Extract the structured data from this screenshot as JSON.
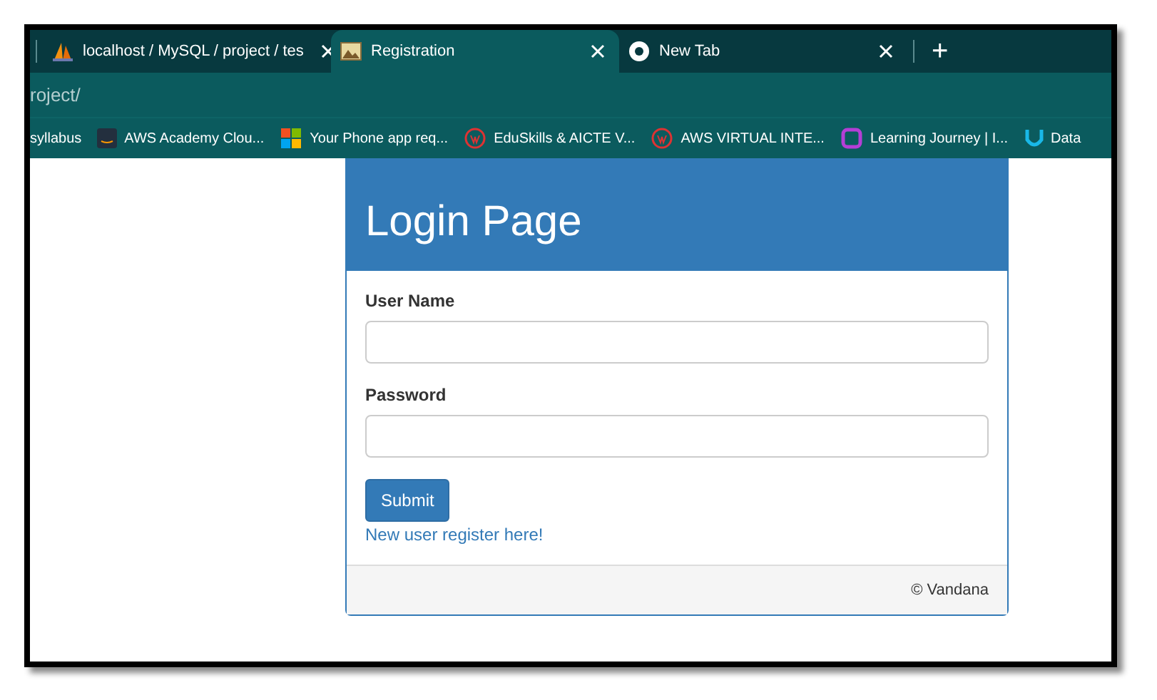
{
  "tabs": [
    {
      "title": "localhost / MySQL / project / tes",
      "selected": false
    },
    {
      "title": "Registration",
      "selected": true
    },
    {
      "title": "New Tab",
      "selected": false
    }
  ],
  "new_tab": "+",
  "address_bar": {
    "value": "roject/"
  },
  "bookmarks": [
    {
      "label": "syllabus"
    },
    {
      "label": "AWS Academy Clou..."
    },
    {
      "label": "Your Phone app req..."
    },
    {
      "label": "EduSkills & AICTE V..."
    },
    {
      "label": "AWS VIRTUAL INTE..."
    },
    {
      "label": "Learning Journey | I..."
    },
    {
      "label": "Data"
    }
  ],
  "login": {
    "title": "Login Page",
    "fields": [
      {
        "label": "User Name"
      },
      {
        "label": "Password"
      }
    ],
    "submit": "Submit",
    "register_link": "New user register here!",
    "footer": "© Vandana"
  }
}
